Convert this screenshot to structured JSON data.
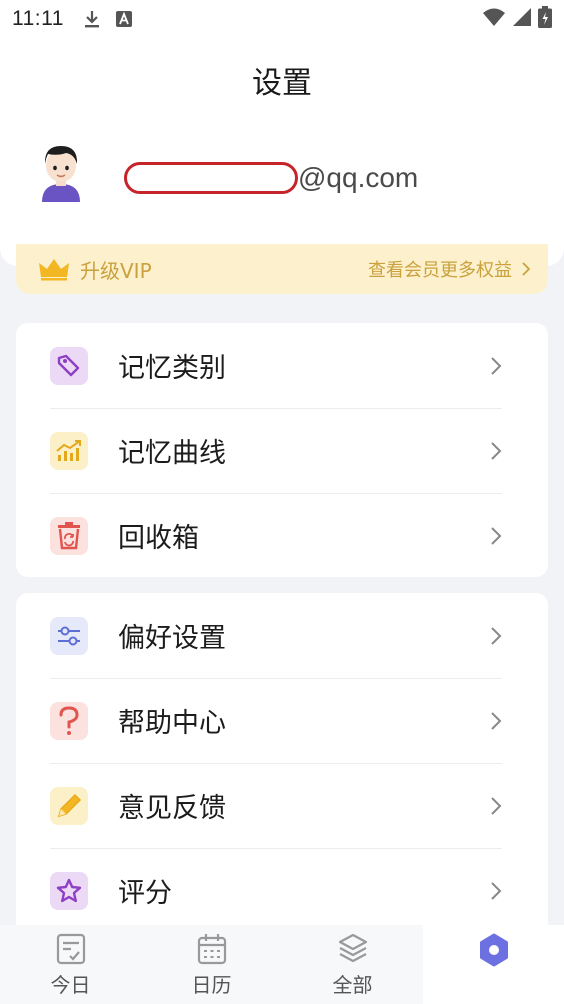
{
  "status_bar": {
    "time": "11:11",
    "icons": [
      "download-icon",
      "a-notification-icon",
      "wifi-icon",
      "signal-icon",
      "battery-icon"
    ]
  },
  "page_title": "设置",
  "profile": {
    "avatar": "user-avatar",
    "email_suffix": "@qq.com"
  },
  "vip": {
    "label": "升级VIP",
    "link_text": "查看会员更多权益",
    "color": "#c9a23e",
    "background": "#fdf0cc"
  },
  "groups": [
    {
      "items": [
        {
          "label": "记忆类别",
          "icon": "tag-icon",
          "icon_color": "#8e3fc4",
          "icon_bg": "#ecd9f6"
        },
        {
          "label": "记忆曲线",
          "icon": "chart-icon",
          "icon_color": "#e2a91c",
          "icon_bg": "#fbf0c8"
        },
        {
          "label": "回收箱",
          "icon": "recycle-bin-icon",
          "icon_color": "#e2554e",
          "icon_bg": "#fbe2df"
        }
      ]
    },
    {
      "items": [
        {
          "label": "偏好设置",
          "icon": "sliders-icon",
          "icon_color": "#5d6fd6",
          "icon_bg": "#e6e9fa"
        },
        {
          "label": "帮助中心",
          "icon": "question-icon",
          "icon_color": "#e2554e",
          "icon_bg": "#fbe2df"
        },
        {
          "label": "意见反馈",
          "icon": "pencil-icon",
          "icon_color": "#e8a91a",
          "icon_bg": "#fbf0c8"
        },
        {
          "label": "评分",
          "icon": "star-icon",
          "icon_color": "#8e3fc4",
          "icon_bg": "#ecd9f6"
        }
      ]
    }
  ],
  "tabs": [
    {
      "label": "今日",
      "icon": "checklist-icon",
      "active": false
    },
    {
      "label": "日历",
      "icon": "calendar-icon",
      "active": false
    },
    {
      "label": "全部",
      "icon": "layers-icon",
      "active": false
    },
    {
      "label": "",
      "icon": "settings-icon",
      "active": true
    }
  ],
  "colors": {
    "accent": "#6c70e0",
    "page_bg": "#f2f3f7"
  }
}
